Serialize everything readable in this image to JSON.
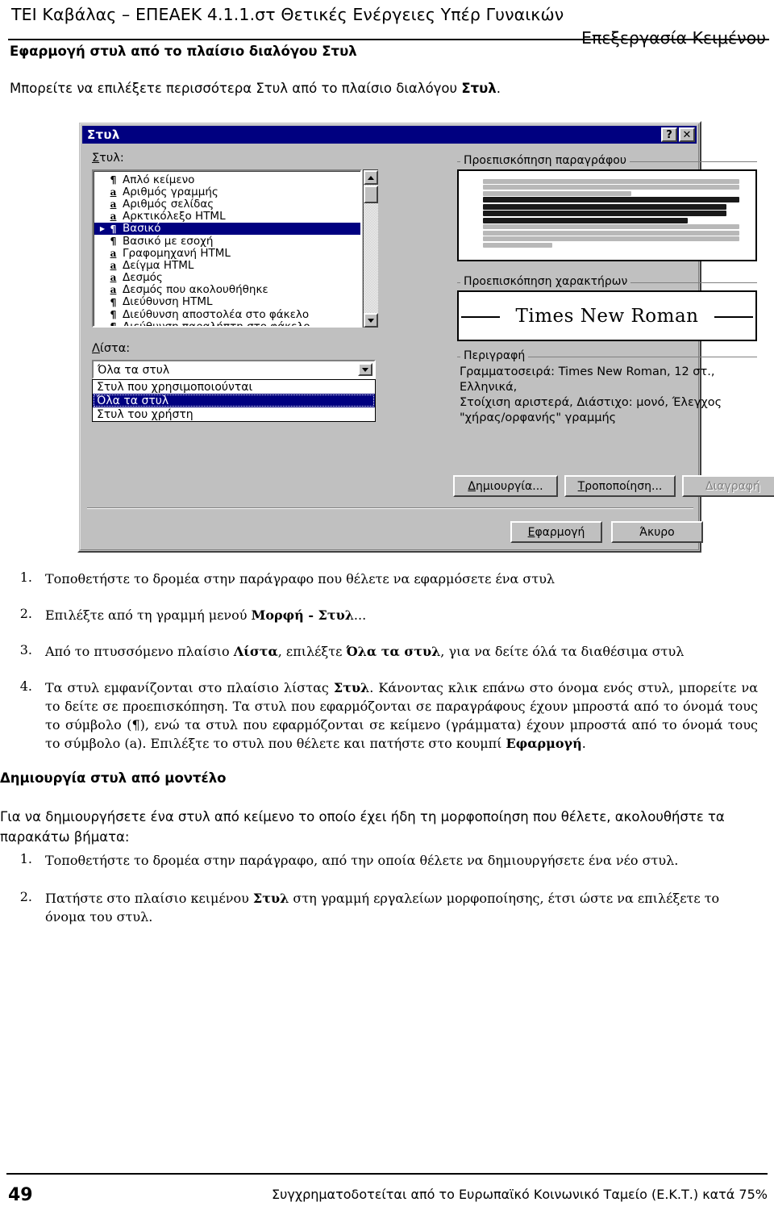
{
  "header": {
    "line1": "ΤΕΙ Καβάλας – ΕΠΕΑΕΚ 4.1.1.στ Θετικές Ενέργειες Υπέρ Γυναικών",
    "line2": "Επεξεργασία Κειμένου"
  },
  "section": {
    "title": "Εφαρμογή στυλ από το πλαίσιο διαλόγου Στυλ",
    "intro_a": "Μπορείτε να επιλέξετε περισσότερα Στυλ από το πλαίσιο διαλόγου ",
    "intro_b": "Στυλ",
    "intro_c": "."
  },
  "dialog": {
    "title": "Στυλ",
    "help_button": "?",
    "close_button": "✕",
    "styles_label": "Στυλ:",
    "styles_list": [
      {
        "icon": "pilcrow-icon",
        "glyph": "¶",
        "label": "Απλό κείμενο",
        "selected": false
      },
      {
        "icon": "character-style-icon",
        "glyph": "a",
        "label": "Αριθμός γραμμής",
        "selected": false
      },
      {
        "icon": "character-style-icon",
        "glyph": "a",
        "label": "Αριθμός σελίδας",
        "selected": false
      },
      {
        "icon": "character-style-icon",
        "glyph": "a",
        "label": "Αρκτικόλεξο HTML",
        "selected": false
      },
      {
        "icon": "pilcrow-icon",
        "glyph": "¶",
        "label": "Βασικό",
        "selected": true
      },
      {
        "icon": "pilcrow-icon",
        "glyph": "¶",
        "label": "Βασικό με εσοχή",
        "selected": false
      },
      {
        "icon": "character-style-icon",
        "glyph": "a",
        "label": "Γραφομηχανή HTML",
        "selected": false
      },
      {
        "icon": "character-style-icon",
        "glyph": "a",
        "label": "Δείγμα HTML",
        "selected": false
      },
      {
        "icon": "character-style-icon",
        "glyph": "a",
        "label": "Δεσμός",
        "selected": false
      },
      {
        "icon": "character-style-icon",
        "glyph": "a",
        "label": "Δεσμός που ακολουθήθηκε",
        "selected": false
      },
      {
        "icon": "pilcrow-icon",
        "glyph": "¶",
        "label": "Διεύθυνση HTML",
        "selected": false
      },
      {
        "icon": "pilcrow-icon",
        "glyph": "¶",
        "label": "Διεύθυνση αποστολέα στο φάκελο",
        "selected": false
      },
      {
        "icon": "pilcrow-icon",
        "glyph": "¶",
        "label": "Διεύθυνση παραλήπτη στο φάκελο",
        "selected": false
      }
    ],
    "list_label": "Λίστα:",
    "list_value": "Όλα τα στυλ",
    "list_options": [
      {
        "label": "Στυλ που χρησιμοποιούνται",
        "selected": false
      },
      {
        "label": "Όλα τα στυλ",
        "selected": true
      },
      {
        "label": "Στυλ του χρήστη",
        "selected": false
      }
    ],
    "para_preview_legend": "Προεπισκόπηση παραγράφου",
    "char_preview_legend": "Προεπισκόπηση χαρακτήρων",
    "char_preview_text": "Times New Roman",
    "description_legend": "Περιγραφή",
    "description_line1": "Γραμματοσειρά: Times New Roman, 12 στ., Ελληνικά,",
    "description_line2": "Στοίχιση αριστερά, Διάστιχο: μονό, Έλεγχος",
    "description_line3": "\"χήρας/ορφανής\" γραμμής",
    "buttons": {
      "new": "Δημιουργία...",
      "modify": "Τροποποίηση...",
      "delete": "Διαγραφή",
      "apply": "Εφαρμογή",
      "cancel": "Άκυρο"
    },
    "colors": {
      "titlebar": "#000080",
      "face": "#c0c0c0",
      "selection": "#000080"
    }
  },
  "steps1": [
    {
      "num": "1.",
      "text": "Τοποθετήστε το δρομέα στην παράγραφο που θέλετε να εφαρμόσετε ένα στυλ"
    },
    {
      "num": "2.",
      "pre": "Επιλέξτε από τη γραμμή μενού ",
      "bold": "Μορφή - Στυλ",
      "post": "..."
    },
    {
      "num": "3.",
      "pre": "Από το πτυσσόμενο πλαίσιο ",
      "bold": "Λίστα",
      "mid": ", επιλέξτε ",
      "bold2": "Όλα τα στυλ",
      "post": ", για να δείτε όλά τα διαθέσιμα στυλ"
    },
    {
      "num": "4.",
      "text_parts": [
        "Τα στυλ εμφανίζονται στο πλαίσιο λίστας ",
        "Στυλ",
        ". Κάνοντας κλικ επάνω στο όνομα ενός στυλ, μπορείτε να το δείτε σε προεπισκόπηση. Τα στυλ που εφαρμόζονται σε παραγράφους έχουν μπροστά από το όνομά τους το σύμβολο (¶), ενώ τα στυλ που εφαρμόζονται σε κείμενο (γράμματα) έχουν μπροστά από το όνομά τους το σύμβολο (a). Επιλέξτε το στυλ που θέλετε και πατήστε στο κουμπί ",
        "Εφαρμογή",
        "."
      ]
    }
  ],
  "subsection": {
    "title": "Δημιουργία στυλ από μοντέλο",
    "para": "Για να δημιουργήσετε ένα στυλ από κείμενο το οποίο έχει ήδη τη μορφοποίηση που θέλετε, ακολουθήστε τα παρακάτω βήματα:"
  },
  "steps2": [
    {
      "num": "1.",
      "text": "Τοποθετήστε το δρομέα στην παράγραφο, από την οποία θέλετε να δημιουργήσετε ένα νέο στυλ."
    },
    {
      "num": "2.",
      "pre": "Πατήστε στο πλαίσιο κειμένου ",
      "bold": "Στυλ",
      "post": " στη γραμμή εργαλείων μορφοποίησης, έτσι ώστε να επιλέξετε το όνομα του στυλ."
    }
  ],
  "footer": {
    "page_number": "49",
    "text": "Συγχρηματοδοτείται από το Ευρωπαϊκό Κοινωνικό Ταμείο (Ε.Κ.Τ.) κατά 75%"
  }
}
